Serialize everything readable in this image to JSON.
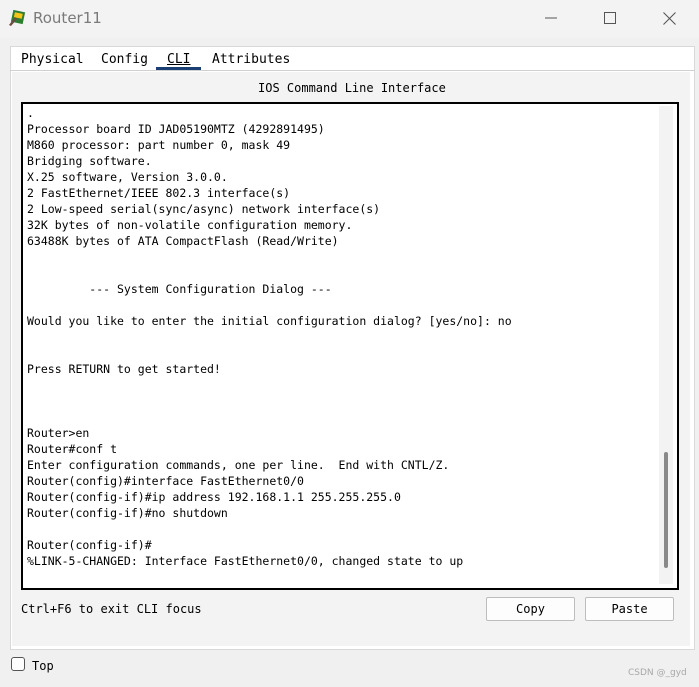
{
  "window": {
    "title": "Router11",
    "icon": "router-app-icon"
  },
  "tabs": [
    {
      "label": "Physical",
      "active": false
    },
    {
      "label": "Config",
      "active": false
    },
    {
      "label": "CLI",
      "active": true
    },
    {
      "label": "Attributes",
      "active": false
    }
  ],
  "cli": {
    "heading": "IOS Command Line Interface",
    "lines": [
      ".",
      "Processor board ID JAD05190MTZ (4292891495)",
      "M860 processor: part number 0, mask 49",
      "Bridging software.",
      "X.25 software, Version 3.0.0.",
      "2 FastEthernet/IEEE 802.3 interface(s)",
      "2 Low-speed serial(sync/async) network interface(s)",
      "32K bytes of non-volatile configuration memory.",
      "63488K bytes of ATA CompactFlash (Read/Write)",
      "",
      "",
      "         --- System Configuration Dialog ---",
      "",
      "Would you like to enter the initial configuration dialog? [yes/no]: no",
      "",
      "",
      "Press RETURN to get started!",
      "",
      "",
      "",
      "Router>en",
      "Router#conf t",
      "Enter configuration commands, one per line.  End with CNTL/Z.",
      "Router(config)#interface FastEthernet0/0",
      "Router(config-if)#ip address 192.168.1.1 255.255.255.0",
      "Router(config-if)#no shutdown",
      "",
      "Router(config-if)#",
      "%LINK-5-CHANGED: Interface FastEthernet0/0, changed state to up"
    ]
  },
  "footer": {
    "focus_hint": "Ctrl+F6 to exit CLI focus",
    "copy_label": "Copy",
    "paste_label": "Paste"
  },
  "bottom": {
    "top_label": "Top",
    "top_checked": false
  },
  "watermark": "CSDN @_gyd"
}
